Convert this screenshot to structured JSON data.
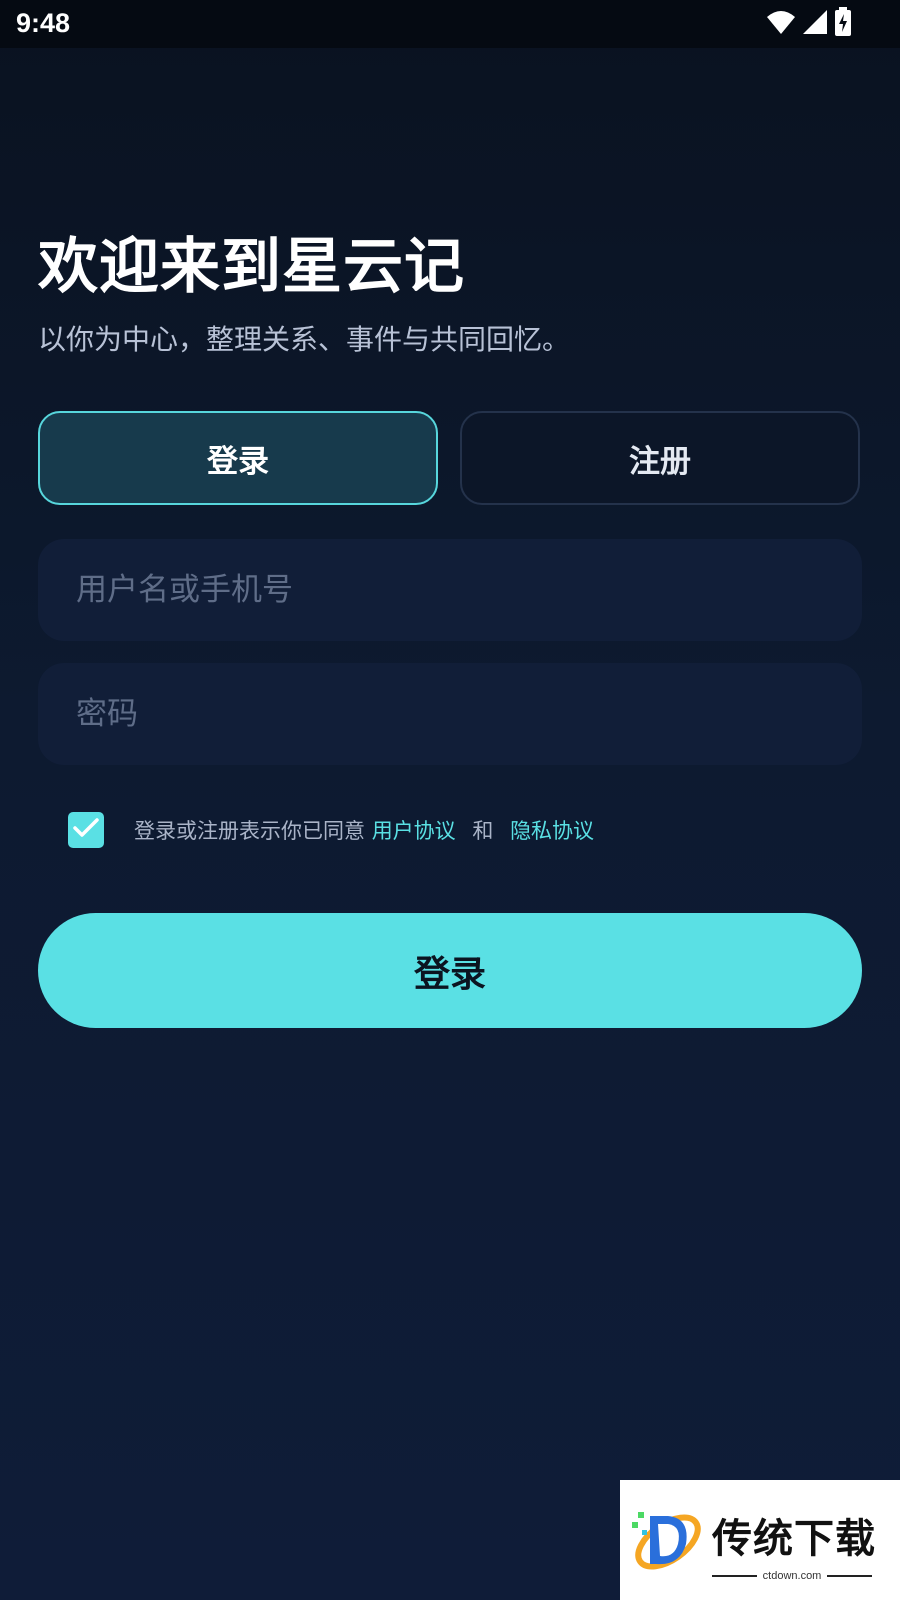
{
  "status_bar": {
    "time": "9:48",
    "icons": [
      "wifi-icon",
      "signal-icon",
      "battery-charging-icon"
    ]
  },
  "header": {
    "title": "欢迎来到星云记",
    "subtitle": "以你为中心，整理关系、事件与共同回忆。"
  },
  "tabs": {
    "login_label": "登录",
    "register_label": "注册",
    "active": "login"
  },
  "form": {
    "username_placeholder": "用户名或手机号",
    "username_value": "",
    "password_placeholder": "密码",
    "password_value": ""
  },
  "agreement": {
    "checked": true,
    "text": "登录或注册表示你已同意",
    "user_agreement": "用户协议",
    "and": "和",
    "privacy_policy": "隐私协议"
  },
  "submit": {
    "label": "登录"
  },
  "watermark": {
    "title": "传统下载",
    "url": "ctdown.com"
  },
  "colors": {
    "accent": "#5ae0e4",
    "background": "#0d1a30",
    "field": "#111e38",
    "tab_active_bg": "#173a4c"
  }
}
